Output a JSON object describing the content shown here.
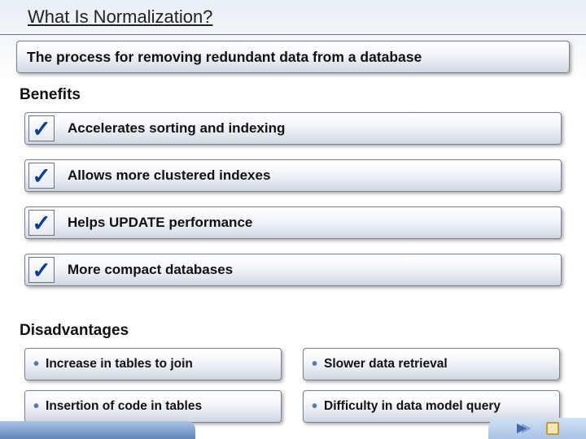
{
  "title": "What Is Normalization?",
  "definition": "The process for removing redundant data from a database",
  "sections": {
    "benefits_label": "Benefits",
    "disadvantages_label": "Disadvantages"
  },
  "benefits": [
    "Accelerates sorting and indexing",
    "Allows more clustered indexes",
    "Helps UPDATE performance",
    "More compact databases"
  ],
  "disadvantages": [
    "Increase in tables to join",
    "Slower data retrieval",
    "Insertion of code in tables",
    "Difficulty in data model query"
  ],
  "icons": {
    "check": "✓",
    "bullet": "•"
  }
}
